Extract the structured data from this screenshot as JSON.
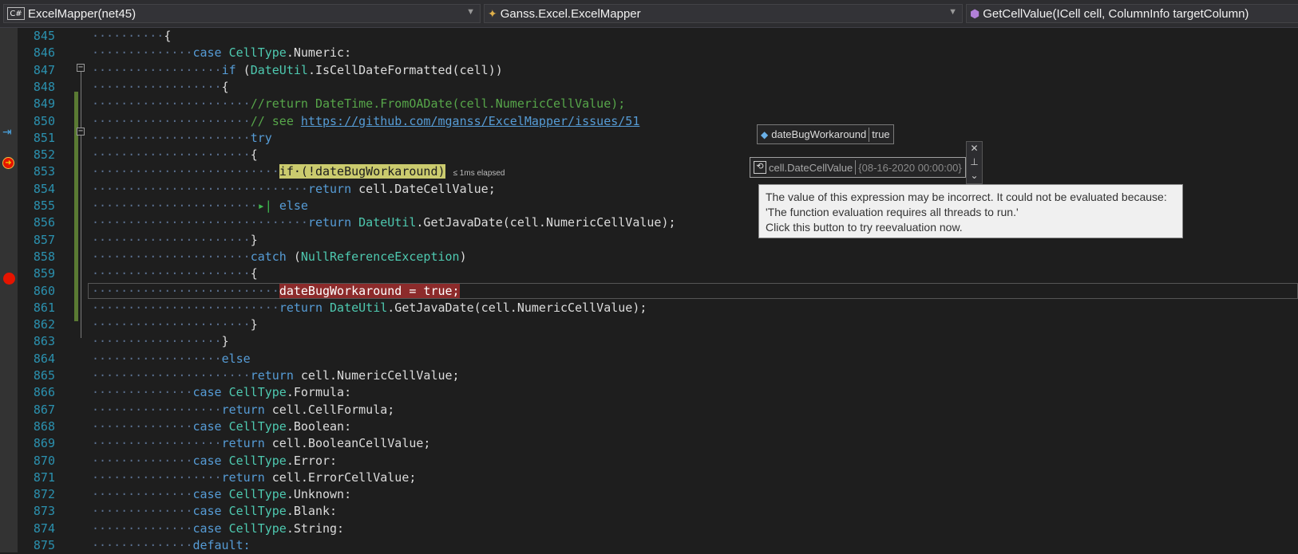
{
  "navbar": {
    "project": "ExcelMapper(net45)",
    "namespace": "Ganss.Excel.ExcelMapper",
    "member": "GetCellValue(ICell cell, ColumnInfo targetColumn)",
    "project_icon_text": "C#",
    "dropdown_icon": "chevron-down-icon"
  },
  "code_lines": [
    {
      "n": "845"
    },
    {
      "n": "846"
    },
    {
      "n": "847"
    },
    {
      "n": "848"
    },
    {
      "n": "849"
    },
    {
      "n": "850"
    },
    {
      "n": "851"
    },
    {
      "n": "852"
    },
    {
      "n": "853"
    },
    {
      "n": "854"
    },
    {
      "n": "855"
    },
    {
      "n": "856"
    },
    {
      "n": "857"
    },
    {
      "n": "858"
    },
    {
      "n": "859"
    },
    {
      "n": "860"
    },
    {
      "n": "861"
    },
    {
      "n": "862"
    },
    {
      "n": "863"
    },
    {
      "n": "864"
    },
    {
      "n": "865"
    },
    {
      "n": "866"
    },
    {
      "n": "867"
    },
    {
      "n": "868"
    },
    {
      "n": "869"
    },
    {
      "n": "870"
    },
    {
      "n": "871"
    },
    {
      "n": "872"
    },
    {
      "n": "873"
    },
    {
      "n": "874"
    },
    {
      "n": "875"
    }
  ],
  "code_tokens": {
    "l845": "{",
    "l846_kw": "case",
    "l846_ty": "CellType",
    "l846_rest": ".Numeric:",
    "l847_kw": "if",
    "l847_ty": "DateUtil",
    "l847_rest": ".IsCellDateFormatted(cell))",
    "l848": "{",
    "l849_cm": "//return DateTime.FromOADate(cell.NumericCellValue);",
    "l850_cm": "// see ",
    "l850_link": "https://github.com/mganss/ExcelMapper/issues/51",
    "l851_kw": "try",
    "l852": "{",
    "l853_hl": "if·(!dateBugWorkaround)",
    "l853_elapsed": "≤ 1ms elapsed",
    "l854_kw": "return",
    "l854_rest": " cell.DateCellValue;",
    "l855_kw": "else",
    "l856_kw": "return",
    "l856_ty": "DateUtil",
    "l856_rest": ".GetJavaDate(cell.NumericCellValue);",
    "l857": "}",
    "l858_kw": "catch",
    "l858_ty": "NullReferenceException",
    "l858_rest": ")",
    "l859": "{",
    "l860_hl": "dateBugWorkaround = true;",
    "l861_kw": "return",
    "l861_ty": "DateUtil",
    "l861_rest": ".GetJavaDate(cell.NumericCellValue);",
    "l862": "}",
    "l863": "}",
    "l864_kw": "else",
    "l865_kw": "return",
    "l865_rest": " cell.NumericCellValue;",
    "l866_kw": "case",
    "l866_ty": "CellType",
    "l866_rest": ".Formula:",
    "l867_kw": "return",
    "l867_rest": " cell.CellFormula;",
    "l868_kw": "case",
    "l868_ty": "CellType",
    "l868_rest": ".Boolean:",
    "l869_kw": "return",
    "l869_rest": " cell.BooleanCellValue;",
    "l870_kw": "case",
    "l870_ty": "CellType",
    "l870_rest": ".Error:",
    "l871_kw": "return",
    "l871_rest": " cell.ErrorCellValue;",
    "l872_kw": "case",
    "l872_ty": "CellType",
    "l872_rest": ".Unknown:",
    "l873_kw": "case",
    "l873_ty": "CellType",
    "l873_rest": ".Blank:",
    "l874_kw": "case",
    "l874_ty": "CellType",
    "l874_rest": ".String:",
    "l875_kw": "default:"
  },
  "datatips": {
    "tip1_name": "dateBugWorkaround",
    "tip1_value": "true",
    "tip2_name": "cell.DateCellValue",
    "tip2_value": "{08-16-2020 00:00:00}"
  },
  "tooltip": {
    "line1": "The value of this expression may be incorrect.  It could not be evaluated because:",
    "line2": "'The function evaluation requires all threads to run.'",
    "line3": "Click this button to try reevaluation now."
  },
  "colors": {
    "keyword": "#569cd6",
    "type": "#4ec9b0",
    "comment": "#57a64a",
    "line_number": "#2b91af",
    "current_statement": "#cbcb6e",
    "breakpoint": "#e51400"
  }
}
